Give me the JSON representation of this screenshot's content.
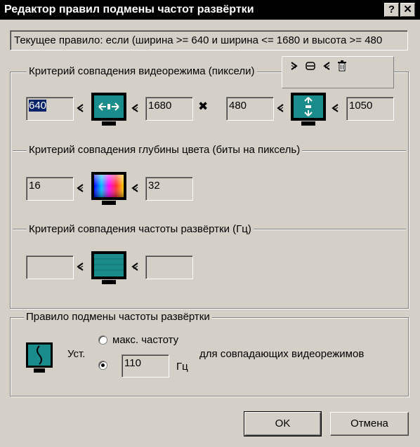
{
  "window": {
    "title": "Редактор правил подмены частот развёртки",
    "help_button": "?",
    "close_button": "✕"
  },
  "current_rule": "Текущее правило: если (ширина >= 640 и ширина <= 1680 и высота >= 480",
  "video_mode": {
    "title": "Критерий совпадения видеорежима (пиксели)",
    "width_min": "640",
    "width_max": "1680",
    "height_min": "480",
    "height_max": "1050",
    "cross": "✖"
  },
  "color_depth": {
    "title": "Критерий совпадения глубины цвета (биты на пиксель)",
    "min": "16",
    "max": "32"
  },
  "refresh": {
    "title": "Критерий совпадения частоты развёртки (Гц)",
    "min": "",
    "max": ""
  },
  "override": {
    "title": "Правило подмены частоты развёртки",
    "set_label": "Уст.",
    "max_freq_label": "макс. частоту",
    "freq_value": "110",
    "unit": "Гц",
    "suffix": "для совпадающих видеорежимов",
    "selected": "custom"
  },
  "buttons": {
    "ok": "OK",
    "cancel": "Отмена"
  },
  "colors": {
    "monitor_screen": "#1a8c8c",
    "selection": "#0a246a"
  }
}
